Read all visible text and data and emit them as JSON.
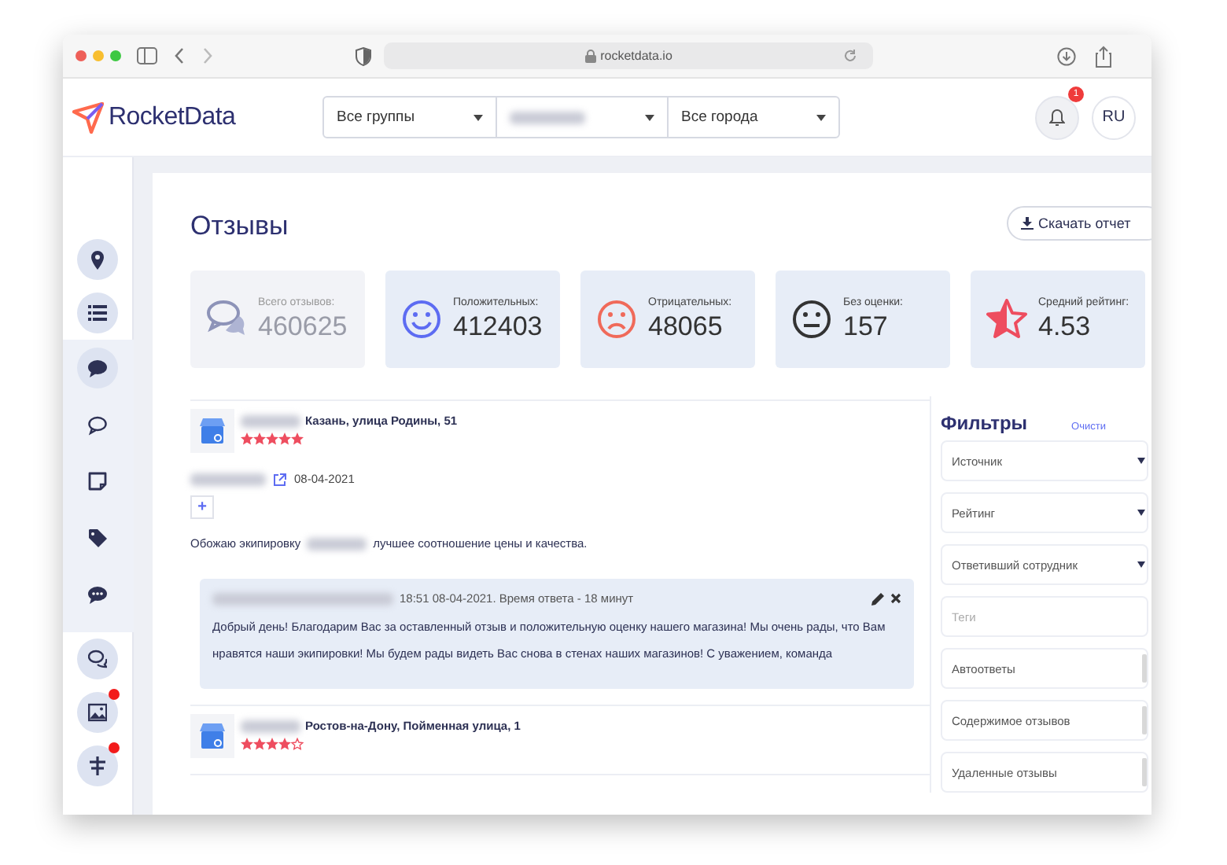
{
  "browser": {
    "url": "rocketdata.io"
  },
  "header": {
    "logo": "RocketData",
    "selects": [
      {
        "value": "Все группы",
        "blurred": false
      },
      {
        "blurred": true
      },
      {
        "value": "Все города",
        "blurred": false
      }
    ],
    "notifications": {
      "badge": "1"
    },
    "language": "RU"
  },
  "sidebar": {
    "items": [
      {
        "kind": "pin",
        "circled": true,
        "badge": false
      },
      {
        "kind": "list",
        "circled": true,
        "badge": false
      },
      {
        "kind": "chat",
        "circled": true,
        "badge": false,
        "expanded": true,
        "children": [
          {
            "kind": "chat-outline",
            "circled": false,
            "badge": false
          },
          {
            "kind": "note",
            "circled": false,
            "badge": false
          },
          {
            "kind": "tag",
            "circled": false,
            "badge": false
          },
          {
            "kind": "chat-dots",
            "circled": false,
            "badge": false
          }
        ]
      },
      {
        "kind": "chats",
        "circled": true,
        "badge": false
      },
      {
        "kind": "image",
        "circled": true,
        "badge": true
      },
      {
        "kind": "signpost",
        "circled": true,
        "badge": true
      }
    ]
  },
  "page": {
    "title": "Отзывы",
    "download_button": "Скачать отчет"
  },
  "stats": [
    {
      "kind": "total",
      "label": "Всего отзывов:",
      "value": "460625"
    },
    {
      "kind": "positive",
      "label": "Положительных:",
      "value": "412403"
    },
    {
      "kind": "negative",
      "label": "Отрицательных:",
      "value": "48065"
    },
    {
      "kind": "neutral",
      "label": "Без оценки:",
      "value": "157"
    },
    {
      "kind": "rating",
      "label": "Средний рейтинг:",
      "value": "4.53"
    }
  ],
  "reviews": [
    {
      "address": "Казань, улица Родины, 51",
      "stars": 5,
      "date": "08-04-2021",
      "add": "+",
      "text": "Обожаю экипировку",
      "text_after": "лучшее соотношение цены и качества.",
      "reply": {
        "meta": "18:51 08-04-2021. Время ответа - 18 минут",
        "text": "Добрый день! Благодарим Вас за оставленный отзыв и положительную оценку нашего магазина! Мы очень рады, что Вам нравятся наши экипировки! Мы будем рады видеть Вас снова в стенах наших магазинов! С уважением, команда"
      }
    },
    {
      "address": "Ростов-на-Дону, Пойменная улица, 1",
      "stars": 4
    }
  ],
  "filters": {
    "title": "Фильтры",
    "clear": "Очисти",
    "fields": [
      {
        "kind": "select",
        "label": "Источник"
      },
      {
        "kind": "select",
        "label": "Рейтинг"
      },
      {
        "kind": "select",
        "label": "Ответивший сотрудник"
      },
      {
        "kind": "tags",
        "placeholder": "Теги"
      },
      {
        "kind": "toggle",
        "label": "Автоответы"
      },
      {
        "kind": "toggle",
        "label": "Содержимое отзывов"
      },
      {
        "kind": "toggle",
        "label": "Удаленные отзывы"
      }
    ]
  }
}
